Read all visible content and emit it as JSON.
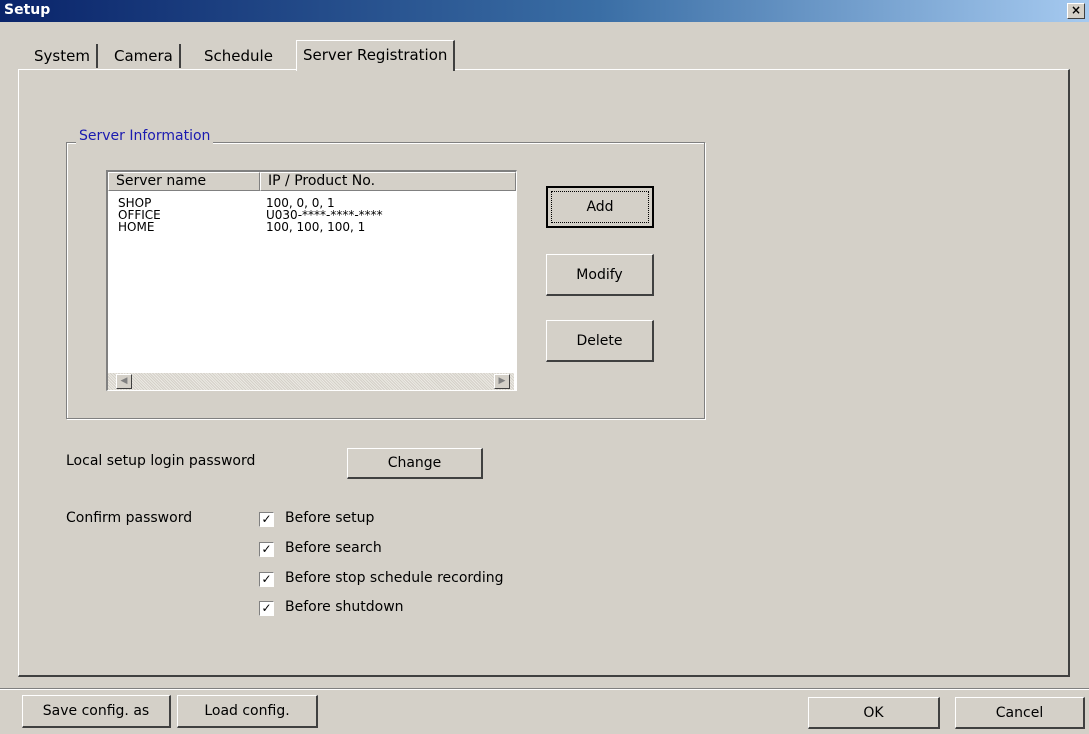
{
  "window": {
    "title": "Setup",
    "close_glyph": "×"
  },
  "tabs": [
    {
      "label": "System",
      "active": false
    },
    {
      "label": "Camera",
      "active": false
    },
    {
      "label": "Schedule",
      "active": false
    },
    {
      "label": "Server Registration",
      "active": true
    }
  ],
  "server_info": {
    "group_label": "Server Information",
    "columns": [
      "Server name",
      "IP / Product No."
    ],
    "rows": [
      {
        "name": "SHOP",
        "address": "100, 0, 0, 1"
      },
      {
        "name": "OFFICE",
        "address": "U030-****-****-****"
      },
      {
        "name": "HOME",
        "address": "100, 100, 100, 1"
      }
    ],
    "buttons": {
      "add": "Add",
      "modify": "Modify",
      "delete": "Delete"
    },
    "scroll_left_glyph": "◀",
    "scroll_right_glyph": "▶"
  },
  "password": {
    "label": "Local setup login password",
    "change_button": "Change"
  },
  "confirm": {
    "label": "Confirm password",
    "options": [
      {
        "label": "Before setup",
        "checked": true
      },
      {
        "label": "Before search",
        "checked": true
      },
      {
        "label": "Before stop schedule recording",
        "checked": true
      },
      {
        "label": "Before shutdown",
        "checked": true
      }
    ],
    "check_glyph": "✓"
  },
  "footer": {
    "save_config": "Save config. as",
    "load_config": "Load config.",
    "ok": "OK",
    "cancel": "Cancel"
  }
}
